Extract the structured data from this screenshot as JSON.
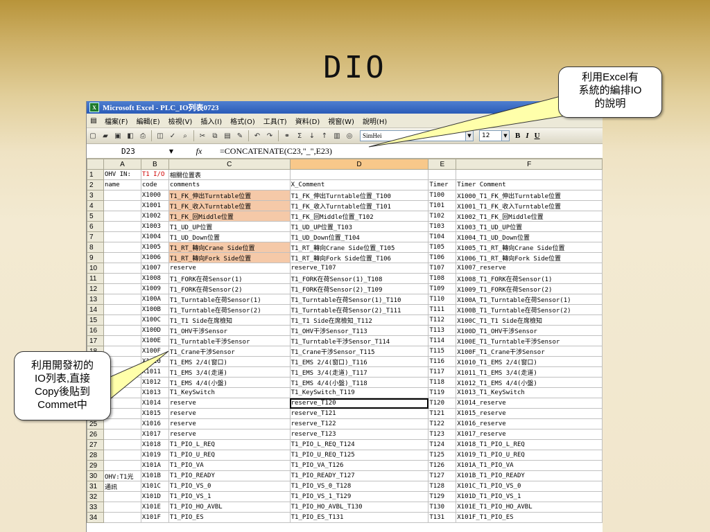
{
  "slide": {
    "title": "DIO",
    "callout_top": [
      "利用Excel有",
      "系統的編排IO",
      "的說明"
    ],
    "callout_left": [
      "利用開發初的",
      "IO列表,直接",
      "Copy後貼到",
      "Commet中"
    ]
  },
  "window": {
    "title": "Microsoft Excel - PLC_IO列表0723",
    "menus": [
      "檔案(F)",
      "編輯(E)",
      "檢視(V)",
      "插入(I)",
      "格式(O)",
      "工具(T)",
      "資料(D)",
      "視窗(W)",
      "說明(H)"
    ],
    "font_name": "SimHei",
    "font_size": "12",
    "bold_label": "B",
    "italic_label": "I",
    "underline_label": "U",
    "name_box": "D23",
    "fx_label": "fx",
    "formula": "=CONCATENATE(C23,\"_\",E23)"
  },
  "grid": {
    "columns": [
      "A",
      "B",
      "C",
      "D",
      "E",
      "F"
    ],
    "selected_column": "D",
    "rows": [
      {
        "n": "1",
        "a": "OHV IN:",
        "b": "T1 I/O",
        "c": "相關位置表",
        "d": "",
        "e": "",
        "f": ""
      },
      {
        "n": "2",
        "a": "name",
        "b": "code",
        "c": "comments",
        "d": "X_Comment",
        "e": "Timer",
        "f": "Timer Comment"
      },
      {
        "n": "3",
        "a": "",
        "b": "X1000",
        "c": "T1_FK_伸出Turntable位置",
        "d": "T1_FK_伸出Turntable位置_T100",
        "e": "T100",
        "f": "X1000_T1_FK_伸出Turntable位置",
        "hl": true
      },
      {
        "n": "4",
        "a": "",
        "b": "X1001",
        "c": "T1_FK_收入Turntable位置",
        "d": "T1_FK_收入Turntable位置_T101",
        "e": "T101",
        "f": "X1001_T1_FK_收入Turntable位置",
        "hl": true
      },
      {
        "n": "5",
        "a": "",
        "b": "X1002",
        "c": "T1_FK_回Middle位置",
        "d": "T1_FK_回Middle位置_T102",
        "e": "T102",
        "f": "X1002_T1_FK_回Middle位置",
        "hl": true
      },
      {
        "n": "6",
        "a": "",
        "b": "X1003",
        "c": "T1_UD_UP位置",
        "d": "T1_UD_UP位置_T103",
        "e": "T103",
        "f": "X1003_T1_UD_UP位置"
      },
      {
        "n": "7",
        "a": "",
        "b": "X1004",
        "c": "T1_UD_Down位置",
        "d": "T1_UD_Down位置_T104",
        "e": "T104",
        "f": "X1004_T1_UD_Down位置"
      },
      {
        "n": "8",
        "a": "",
        "b": "X1005",
        "c": "T1_RT_轉向Crane Side位置",
        "d": "T1_RT_轉向Crane Side位置_T105",
        "e": "T105",
        "f": "X1005_T1_RT_轉向Crane Side位置",
        "hl": true
      },
      {
        "n": "9",
        "a": "",
        "b": "X1006",
        "c": "T1_RT_轉向Fork Side位置",
        "d": "T1_RT_轉向Fork Side位置_T106",
        "e": "T106",
        "f": "X1006_T1_RT_轉向Fork Side位置",
        "hl": true
      },
      {
        "n": "10",
        "a": "",
        "b": "X1007",
        "c": "reserve",
        "d": "reserve_T107",
        "e": "T107",
        "f": "X1007_reserve"
      },
      {
        "n": "11",
        "a": "",
        "b": "X1008",
        "c": "T1_FORK在荷Sensor(1)",
        "d": "T1_FORK在荷Sensor(1)_T108",
        "e": "T108",
        "f": "X1008_T1_FORK在荷Sensor(1)"
      },
      {
        "n": "12",
        "a": "",
        "b": "X1009",
        "c": "T1_FORK在荷Sensor(2)",
        "d": "T1_FORK在荷Sensor(2)_T109",
        "e": "T109",
        "f": "X1009_T1_FORK在荷Sensor(2)"
      },
      {
        "n": "13",
        "a": "",
        "b": "X100A",
        "c": "T1_Turntable在荷Sensor(1)",
        "d": "T1_Turntable在荷Sensor(1)_T110",
        "e": "T110",
        "f": "X100A_T1_Turntable在荷Sensor(1)"
      },
      {
        "n": "14",
        "a": "",
        "b": "X100B",
        "c": "T1_Turntable在荷Sensor(2)",
        "d": "T1_Turntable在荷Sensor(2)_T111",
        "e": "T111",
        "f": "X100B_T1_Turntable在荷Sensor(2)"
      },
      {
        "n": "15",
        "a": "",
        "b": "X100C",
        "c": "T1_T1 Side在席檢知",
        "d": "T1_T1 Side在席檢知_T112",
        "e": "T112",
        "f": "X100C_T1_T1 Side在席檢知"
      },
      {
        "n": "16",
        "a": "",
        "b": "X100D",
        "c": "T1_OHV干涉Sensor",
        "d": "T1_OHV干涉Sensor_T113",
        "e": "T113",
        "f": "X100D_T1_OHV干涉Sensor"
      },
      {
        "n": "17",
        "a": "",
        "b": "X100E",
        "c": "T1_Turntable干涉Sensor",
        "d": "T1_Turntable干涉Sensor_T114",
        "e": "T114",
        "f": "X100E_T1_Turntable干涉Sensor"
      },
      {
        "n": "18",
        "a": "",
        "b": "X100F",
        "c": "T1_Crane干涉Sensor",
        "d": "T1_Crane干涉Sensor_T115",
        "e": "T115",
        "f": "X100F_T1_Crane干涉Sensor"
      },
      {
        "n": "19",
        "a": "",
        "b": "X1010",
        "c": "T1_EMS 2/4(窗口)",
        "d": "T1_EMS 2/4(窗口)_T116",
        "e": "T116",
        "f": "X1010_T1_EMS 2/4(窗口)"
      },
      {
        "n": "20",
        "a": "",
        "b": "X1011",
        "c": "T1_EMS 3/4(走道)",
        "d": "T1_EMS 3/4(走道)_T117",
        "e": "T117",
        "f": "X1011_T1_EMS 3/4(走道)"
      },
      {
        "n": "21",
        "a": "",
        "b": "X1012",
        "c": "T1_EMS 4/4(小盤)",
        "d": "T1_EMS 4/4(小盤)_T118",
        "e": "T118",
        "f": "X1012_T1_EMS 4/4(小盤)"
      },
      {
        "n": "22",
        "a": "",
        "b": "X1013",
        "c": "T1_KeySwitch",
        "d": "T1_KeySwitch_T119",
        "e": "T119",
        "f": "X1013_T1_KeySwitch"
      },
      {
        "n": "23",
        "a": "",
        "b": "X1014",
        "c": "reserve",
        "d": "reserve_T120",
        "e": "T120",
        "f": "X1014_reserve",
        "active": true
      },
      {
        "n": "24",
        "a": "",
        "b": "X1015",
        "c": "reserve",
        "d": "reserve_T121",
        "e": "T121",
        "f": "X1015_reserve"
      },
      {
        "n": "25",
        "a": "",
        "b": "X1016",
        "c": "reserve",
        "d": "reserve_T122",
        "e": "T122",
        "f": "X1016_reserve"
      },
      {
        "n": "26",
        "a": "",
        "b": "X1017",
        "c": "reserve",
        "d": "reserve_T123",
        "e": "T123",
        "f": "X1017_reserve"
      },
      {
        "n": "27",
        "a": "",
        "b": "X1018",
        "c": "T1_PIO_L_REQ",
        "d": "T1_PIO_L_REQ_T124",
        "e": "T124",
        "f": "X1018_T1_PIO_L_REQ"
      },
      {
        "n": "28",
        "a": "",
        "b": "X1019",
        "c": "T1_PIO_U_REQ",
        "d": "T1_PIO_U_REQ_T125",
        "e": "T125",
        "f": "X1019_T1_PIO_U_REQ"
      },
      {
        "n": "29",
        "a": "",
        "b": "X101A",
        "c": "T1_PIO_VA",
        "d": "T1_PIO_VA_T126",
        "e": "T126",
        "f": "X101A_T1_PIO_VA"
      },
      {
        "n": "30",
        "a": "OHV:T1光",
        "b": "X101B",
        "c": "T1_PIO_READY",
        "d": "T1_PIO_READY_T127",
        "e": "T127",
        "f": "X101B_T1_PIO_READY"
      },
      {
        "n": "31",
        "a": "通訊",
        "b": "X101C",
        "c": "T1_PIO_VS_0",
        "d": "T1_PIO_VS_0_T128",
        "e": "T128",
        "f": "X101C_T1_PIO_VS_0"
      },
      {
        "n": "32",
        "a": "",
        "b": "X101D",
        "c": "T1_PIO_VS_1",
        "d": "T1_PIO_VS_1_T129",
        "e": "T129",
        "f": "X101D_T1_PIO_VS_1"
      },
      {
        "n": "33",
        "a": "",
        "b": "X101E",
        "c": "T1_PIO_HO_AVBL",
        "d": "T1_PIO_HO_AVBL_T130",
        "e": "T130",
        "f": "X101E_T1_PIO_HO_AVBL"
      },
      {
        "n": "34",
        "a": "",
        "b": "X101F",
        "c": "T1_PIO_ES",
        "d": "T1_PIO_ES_T131",
        "e": "T131",
        "f": "X101F_T1_PIO_ES"
      }
    ]
  }
}
